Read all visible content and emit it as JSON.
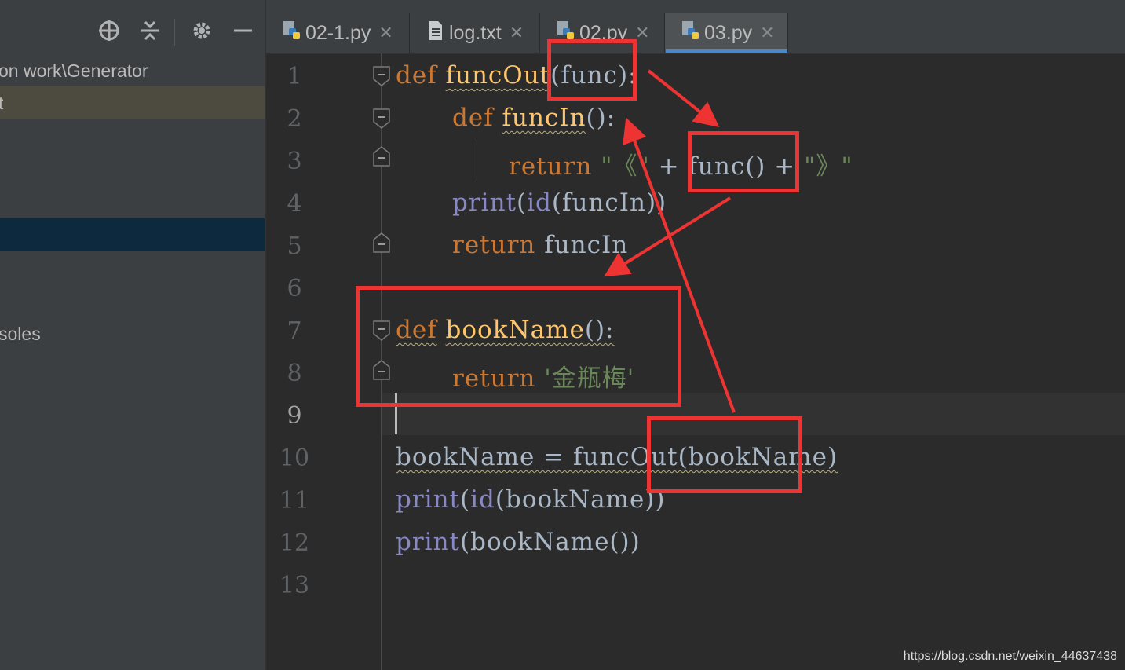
{
  "project_panel": {
    "path_label": "on work\\Generator",
    "selected_item": "t",
    "consoles_label": "soles"
  },
  "tabs": [
    {
      "label": "02-1.py",
      "icon": "python-file-icon"
    },
    {
      "label": "log.txt",
      "icon": "text-file-icon"
    },
    {
      "label": "02.py",
      "icon": "python-file-icon"
    },
    {
      "label": "03.py",
      "icon": "python-file-icon",
      "active": true
    }
  ],
  "editor": {
    "line_numbers": [
      "1",
      "2",
      "3",
      "4",
      "5",
      "6",
      "7",
      "8",
      "9",
      "10",
      "11",
      "12",
      "13"
    ],
    "current_line": "9",
    "lines": {
      "l1": {
        "kw": "def",
        "name": "funcOut",
        "rest": "(func):"
      },
      "l2": {
        "kw": "def",
        "name": "funcIn",
        "rest": "():"
      },
      "l3": {
        "kw": "return",
        "s1": "\"《\"",
        "mid": " + func() + ",
        "s2": "\"》\""
      },
      "l4": {
        "fn": "print",
        "a": "(",
        "fn2": "id",
        "b": "(funcIn))"
      },
      "l5": {
        "kw": "return",
        "rest": " funcIn"
      },
      "l7": {
        "kw": "def",
        "name": "bookName",
        "rest": "():"
      },
      "l8": {
        "kw": "return",
        "str": "'金瓶梅'"
      },
      "l10": {
        "text": "bookName = funcOut(bookName)"
      },
      "l11": {
        "fn": "print",
        "a": "(",
        "fn2": "id",
        "b": "(bookName))"
      },
      "l12": {
        "fn": "print",
        "b": "(bookName())"
      }
    }
  },
  "colors": {
    "keyword": "#cc7832",
    "function_name": "#ffc66d",
    "builtin": "#8888c6",
    "string": "#6a8759",
    "annotation_red": "#ee3333",
    "active_tab_underline": "#4a88c7"
  },
  "watermark": "https://blog.csdn.net/weixin_44637438"
}
